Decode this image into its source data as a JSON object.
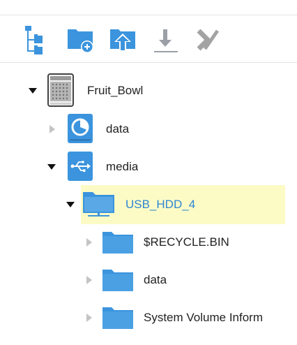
{
  "toolbar": {
    "buttons": [
      {
        "icon": "folder-tree-icon",
        "enabled": true
      },
      {
        "icon": "new-folder-icon",
        "enabled": true
      },
      {
        "icon": "upload-icon",
        "enabled": true
      },
      {
        "icon": "download-icon",
        "enabled": false
      },
      {
        "icon": "delete-icon",
        "enabled": false
      }
    ]
  },
  "tree": {
    "root": {
      "label": "Fruit_Bowl",
      "icon": "nas-device-icon",
      "expanded": true
    },
    "data": {
      "label": "data",
      "icon": "disk-icon",
      "expanded": false
    },
    "media": {
      "label": "media",
      "icon": "usb-icon",
      "expanded": true
    },
    "usb_hdd": {
      "label": "USB_HDD_4",
      "icon": "shared-folder-icon",
      "expanded": true,
      "selected": true
    },
    "recycle": {
      "label": "$RECYCLE.BIN",
      "icon": "folder-icon",
      "expanded": false
    },
    "data2": {
      "label": "data",
      "icon": "folder-icon",
      "expanded": false
    },
    "sysvol": {
      "label": "System Volume Inform",
      "icon": "folder-icon",
      "expanded": false
    }
  },
  "colors": {
    "accent": "#2f86d3",
    "icon_blue": "#3b94dd",
    "disabled": "#9aa0a6",
    "selection": "#fcfbc6"
  }
}
